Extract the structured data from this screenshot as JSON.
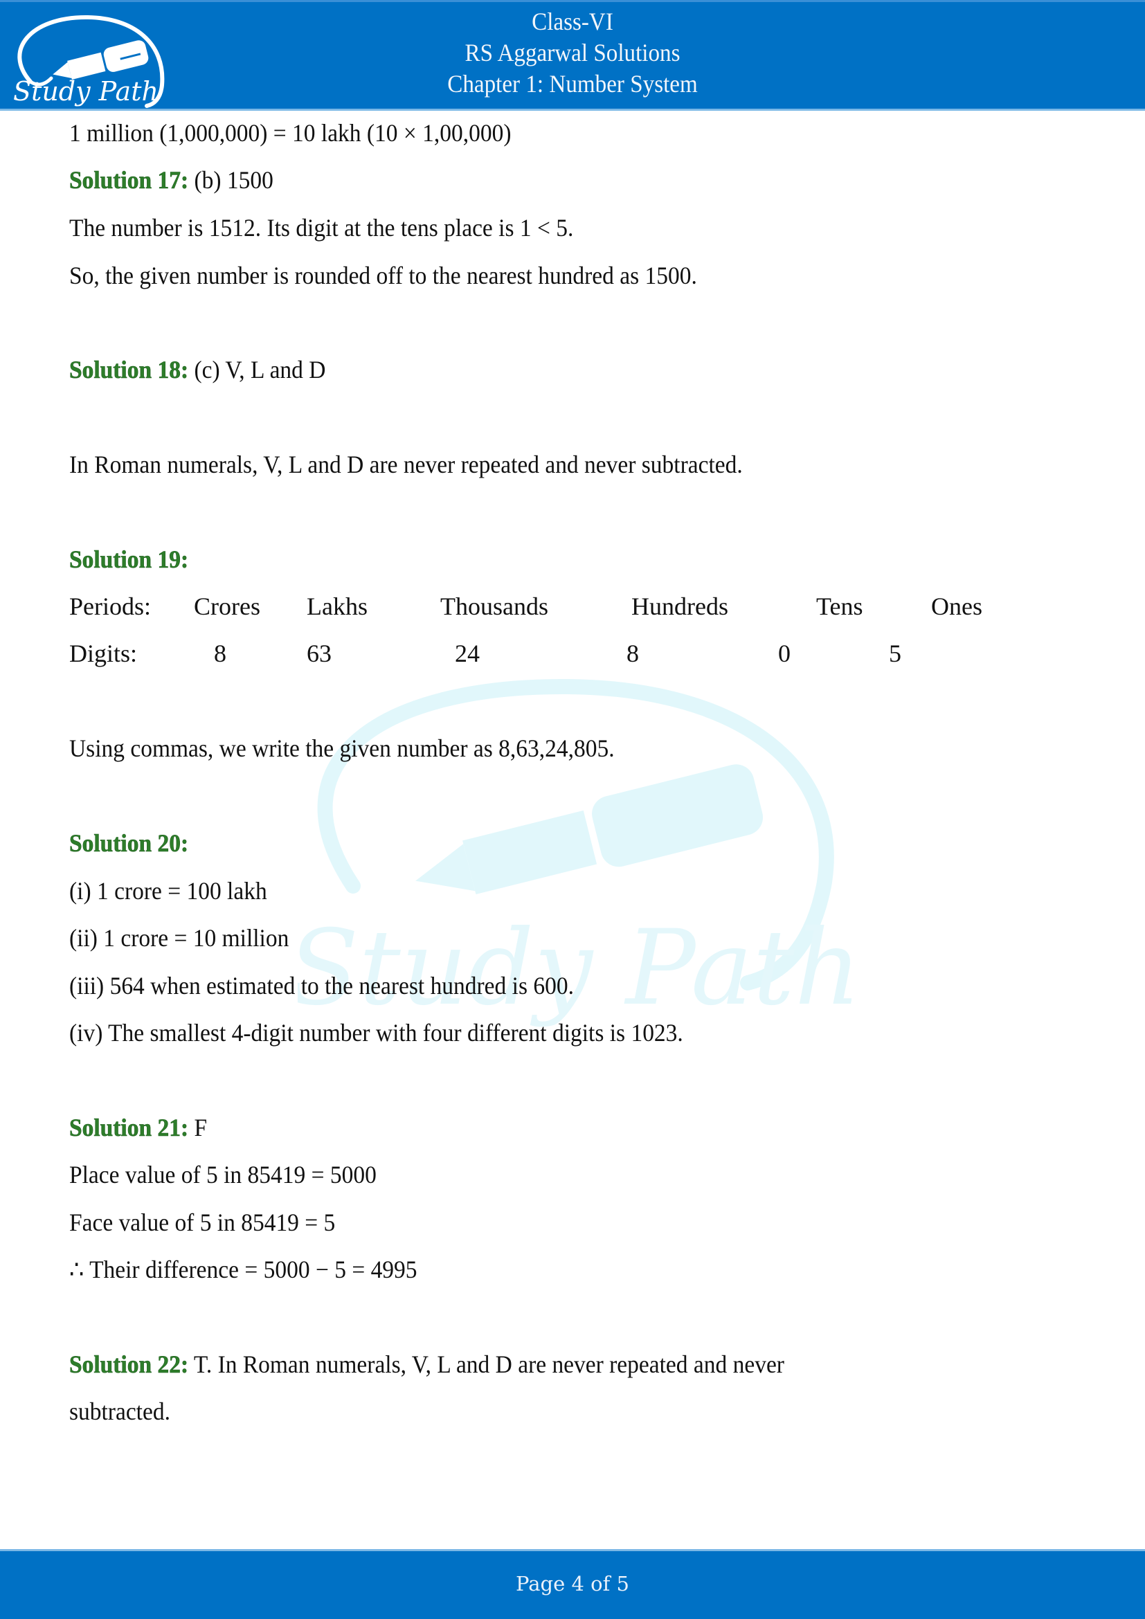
{
  "header": {
    "logo_text": "Study Path",
    "lines": [
      "Class-VI",
      "RS Aggarwal Solutions",
      "Chapter 1: Number System"
    ]
  },
  "content": {
    "intro_line": "1 million (1,000,000) = 10 lakh (10 × 1,00,000)",
    "solutions": [
      {
        "label": "Solution 17:",
        "answer": " (b) 1500",
        "lines": [
          "The number is 1512. Its digit at the tens place is 1 < 5.",
          "So, the given number is rounded off to the nearest hundred as 1500."
        ]
      },
      {
        "label": "Solution 18:",
        "answer": " (c) V, L and D",
        "lines": [
          "In Roman numerals, V, L and D are never repeated and never subtracted."
        ]
      },
      {
        "label": "Solution 19:",
        "answer": "",
        "table": {
          "periods_label": "Periods:",
          "periods": [
            "Crores",
            "Lakhs",
            "Thousands",
            "Hundreds",
            "Tens",
            "Ones"
          ],
          "digits_label": "Digits:",
          "digits": [
            "8",
            "63",
            "24",
            "8",
            "0",
            "5"
          ]
        },
        "lines": [
          "Using commas, we write the given number as 8,63,24,805."
        ]
      },
      {
        "label": "Solution 20:",
        "answer": "",
        "lines": [
          "(i) 1 crore = 100 lakh",
          "(ii) 1 crore = 10 million",
          "(iii) 564 when estimated to the nearest hundred is 600.",
          "(iv) The smallest 4-digit number with four different digits is 1023."
        ]
      },
      {
        "label": "Solution 21:",
        "answer": " F",
        "lines": [
          "Place value of 5 in 85419 = 5000",
          "Face value of 5 in 85419 = 5",
          "∴ Their difference = 5000 − 5 = 4995"
        ]
      },
      {
        "label": "Solution 22:",
        "answer": " T.  In Roman numerals, V, L and D are never repeated and never",
        "lines": [
          "subtracted."
        ]
      }
    ]
  },
  "footer": {
    "page_label": "Page 4 of 5",
    "current_page": 4,
    "total_pages": 5
  },
  "colors": {
    "brand_blue": "#0071c5",
    "solution_green": "#2d7d2a",
    "watermark": "#dff6fb"
  }
}
